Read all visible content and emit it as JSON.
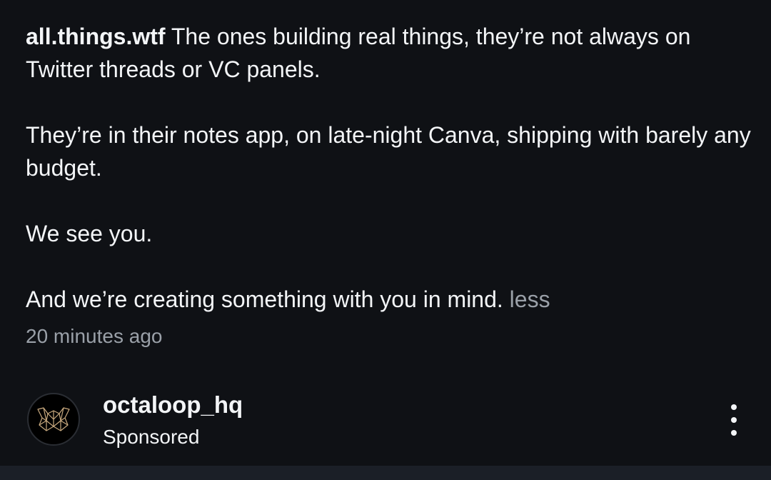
{
  "caption": {
    "username": "all.things.wtf",
    "line1": " The ones building real things, they’re not always on Twitter threads or VC panels.",
    "para2": "They’re in their notes app, on late-night Canva, shipping with barely any budget.",
    "para3": "We see you.",
    "para4": "And we’re creating something with you in mind.",
    "less_label": " less"
  },
  "timestamp": "20 minutes ago",
  "next_post": {
    "account_name": "octaloop_hq",
    "sponsored_label": "Sponsored",
    "avatar_icon": "octaloop-logo-icon",
    "more_icon": "more-options-icon"
  },
  "colors": {
    "background": "#0f1115",
    "text": "#f3f5f7",
    "muted": "#9aa0a8",
    "logo_gold": "#c8a97e"
  }
}
